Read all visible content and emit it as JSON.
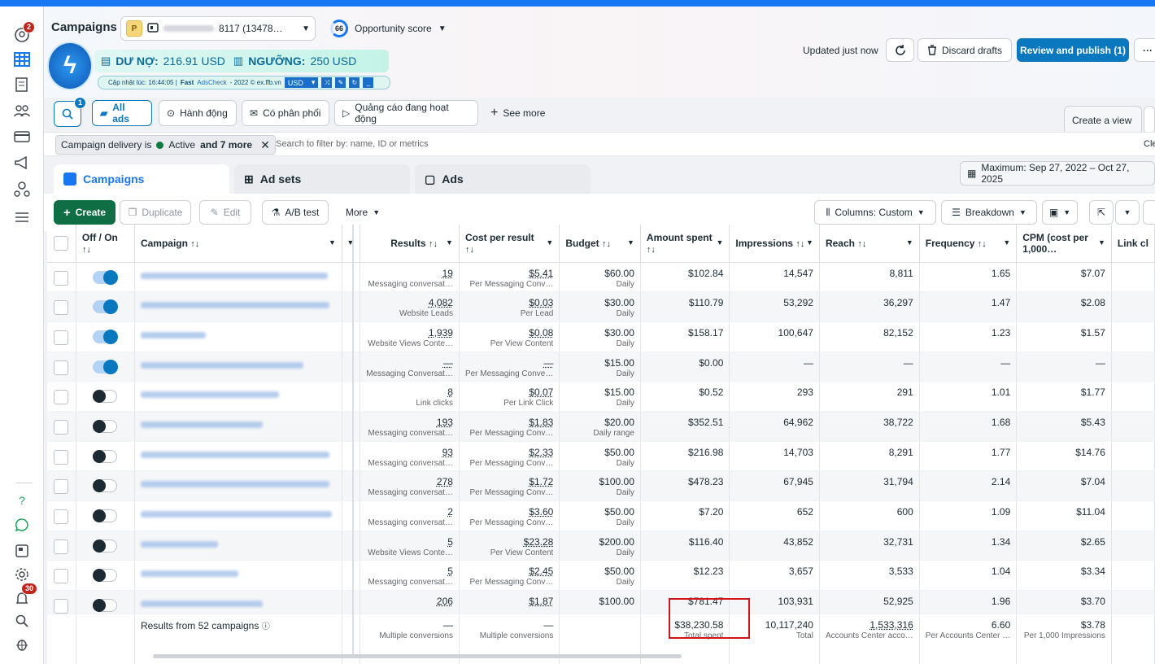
{
  "nav": {
    "notif_badge": "2",
    "alerts_badge": "30",
    "icons": [
      "messages-icon",
      "table-icon",
      "reports-icon",
      "audiences-icon",
      "billing-icon",
      "announcement-icon",
      "users-icon",
      "menu-icon",
      "help-icon",
      "chat-icon",
      "pages-icon",
      "settings-icon",
      "bell-icon",
      "search-icon",
      "bug-icon"
    ]
  },
  "header": {
    "title": "Campaigns",
    "account_badge": "P",
    "account_name": "8117 (13478…",
    "opportunity_score": "66",
    "opportunity_label": "Opportunity score",
    "updated": "Updated just now",
    "discard_label": "Discard drafts",
    "publish_label": "Review and publish (1)",
    "more_label": "···"
  },
  "fast_ads": {
    "debt_label": "DƯ NỢ:",
    "debt_value": "216.91 USD",
    "threshold_label": "NGƯỠNG:",
    "threshold_value": "250 USD",
    "updated_at": "Cập nhật lúc: 16:44:05 |",
    "brand_strong": "Fast",
    "brand": "AdsCheck",
    "brand_rest": "- 2022 © ex.ffb.vn",
    "currency": "USD"
  },
  "filters": {
    "search_badge": "1",
    "all_ads": "All ads",
    "f1": "Hành động",
    "f2": "Có phân phối",
    "f3": "Quảng cáo đang hoạt động",
    "see_more": "See more",
    "create_view": "Create a view",
    "chip_text": "Campaign delivery is",
    "chip_status": "Active",
    "chip_more": "and 7 more",
    "search_placeholder": "Search to filter by: name, ID or metrics",
    "clear": "Cle"
  },
  "tabs": {
    "campaigns": "Campaigns",
    "adsets": "Ad sets",
    "ads": "Ads",
    "date_range": "Maximum: Sep 27, 2022 – Oct 27, 2025"
  },
  "toolbar": {
    "create": "Create",
    "duplicate": "Duplicate",
    "edit": "Edit",
    "abtest": "A/B test",
    "more": "More",
    "columns": "Columns: Custom",
    "breakdown": "Breakdown"
  },
  "table": {
    "headers": {
      "offon": "Off / On",
      "campaign": "Campaign",
      "results": "Results",
      "cpr": "Cost per result",
      "budget": "Budget",
      "spent": "Amount spent",
      "impressions": "Impressions",
      "reach": "Reach",
      "frequency": "Frequency",
      "cpm": "CPM (cost per 1,000…",
      "link": "Link cl"
    },
    "rows": [
      {
        "on": true,
        "results": "19",
        "results_sub": "Messaging conversat…",
        "cpr": "$5.41",
        "cpr_sub": "Per Messaging Conv…",
        "budget": "$60.00",
        "budget_sub": "Daily",
        "spent": "$102.84",
        "impr": "14,547",
        "reach": "8,811",
        "freq": "1.65",
        "cpm": "$7.07"
      },
      {
        "on": true,
        "results": "4,082",
        "results_sub": "Website Leads",
        "cpr": "$0.03",
        "cpr_sub": "Per Lead",
        "budget": "$30.00",
        "budget_sub": "Daily",
        "spent": "$110.79",
        "impr": "53,292",
        "reach": "36,297",
        "freq": "1.47",
        "cpm": "$2.08"
      },
      {
        "on": true,
        "results": "1,939",
        "results_sub": "Website Views Conte…",
        "cpr": "$0.08",
        "cpr_sub": "Per View Content",
        "budget": "$30.00",
        "budget_sub": "Daily",
        "spent": "$158.17",
        "impr": "100,647",
        "reach": "82,152",
        "freq": "1.23",
        "cpm": "$1.57"
      },
      {
        "on": true,
        "results": "—",
        "results_sub": "Messaging Conversat…",
        "cpr": "—",
        "cpr_sub": "Per Messaging Conve…",
        "budget": "$15.00",
        "budget_sub": "Daily",
        "spent": "$0.00",
        "impr": "—",
        "reach": "—",
        "freq": "—",
        "cpm": "—"
      },
      {
        "on": false,
        "results": "8",
        "results_sub": "Link clicks",
        "cpr": "$0.07",
        "cpr_sub": "Per Link Click",
        "budget": "$15.00",
        "budget_sub": "Daily",
        "spent": "$0.52",
        "impr": "293",
        "reach": "291",
        "freq": "1.01",
        "cpm": "$1.77"
      },
      {
        "on": false,
        "results": "193",
        "results_sub": "Messaging conversat…",
        "cpr": "$1.83",
        "cpr_sub": "Per Messaging Conv…",
        "budget": "$20.00",
        "budget_sub": "Daily range",
        "spent": "$352.51",
        "impr": "64,962",
        "reach": "38,722",
        "freq": "1.68",
        "cpm": "$5.43"
      },
      {
        "on": false,
        "results": "93",
        "results_sub": "Messaging conversat…",
        "cpr": "$2.33",
        "cpr_sub": "Per Messaging Conv…",
        "budget": "$50.00",
        "budget_sub": "Daily",
        "spent": "$216.98",
        "impr": "14,703",
        "reach": "8,291",
        "freq": "1.77",
        "cpm": "$14.76"
      },
      {
        "on": false,
        "results": "278",
        "results_sub": "Messaging conversat…",
        "cpr": "$1.72",
        "cpr_sub": "Per Messaging Conv…",
        "budget": "$100.00",
        "budget_sub": "Daily",
        "spent": "$478.23",
        "impr": "67,945",
        "reach": "31,794",
        "freq": "2.14",
        "cpm": "$7.04"
      },
      {
        "on": false,
        "results": "2",
        "results_sub": "Messaging conversat…",
        "cpr": "$3.60",
        "cpr_sub": "Per Messaging Conv…",
        "budget": "$50.00",
        "budget_sub": "Daily",
        "spent": "$7.20",
        "impr": "652",
        "reach": "600",
        "freq": "1.09",
        "cpm": "$11.04"
      },
      {
        "on": false,
        "results": "5",
        "results_sub": "Website Views Conte…",
        "cpr": "$23.28",
        "cpr_sub": "Per View Content",
        "budget": "$200.00",
        "budget_sub": "Daily",
        "spent": "$116.40",
        "impr": "43,852",
        "reach": "32,731",
        "freq": "1.34",
        "cpm": "$2.65"
      },
      {
        "on": false,
        "results": "5",
        "results_sub": "Messaging conversat…",
        "cpr": "$2.45",
        "cpr_sub": "Per Messaging Conv…",
        "budget": "$50.00",
        "budget_sub": "Daily",
        "spent": "$12.23",
        "impr": "3,657",
        "reach": "3,533",
        "freq": "1.04",
        "cpm": "$3.34"
      },
      {
        "on": false,
        "results": "206",
        "results_sub": "",
        "cpr": "$1.87",
        "cpr_sub": "",
        "budget": "$100.00",
        "budget_sub": "",
        "spent": "$781.47",
        "impr": "103,931",
        "reach": "52,925",
        "freq": "1.96",
        "cpm": "$3.70"
      }
    ],
    "summary": {
      "label": "Results from 52 campaigns",
      "results": "—",
      "results_sub": "Multiple conversions",
      "cpr": "—",
      "cpr_sub": "Multiple conversions",
      "spent": "$38,230.58",
      "spent_sub": "Total spent",
      "impr": "10,117,240",
      "impr_sub": "Total",
      "reach": "1,533,316",
      "reach_sub": "Accounts Center acco…",
      "freq": "6.60",
      "freq_sub": "Per Accounts Center …",
      "cpm": "$3.78",
      "cpm_sub": "Per 1,000 Impressions"
    }
  },
  "colors": {
    "brand": "#1877f2",
    "publish": "#0a78be",
    "create": "#0f6e43",
    "highlight": "#d1131b"
  }
}
